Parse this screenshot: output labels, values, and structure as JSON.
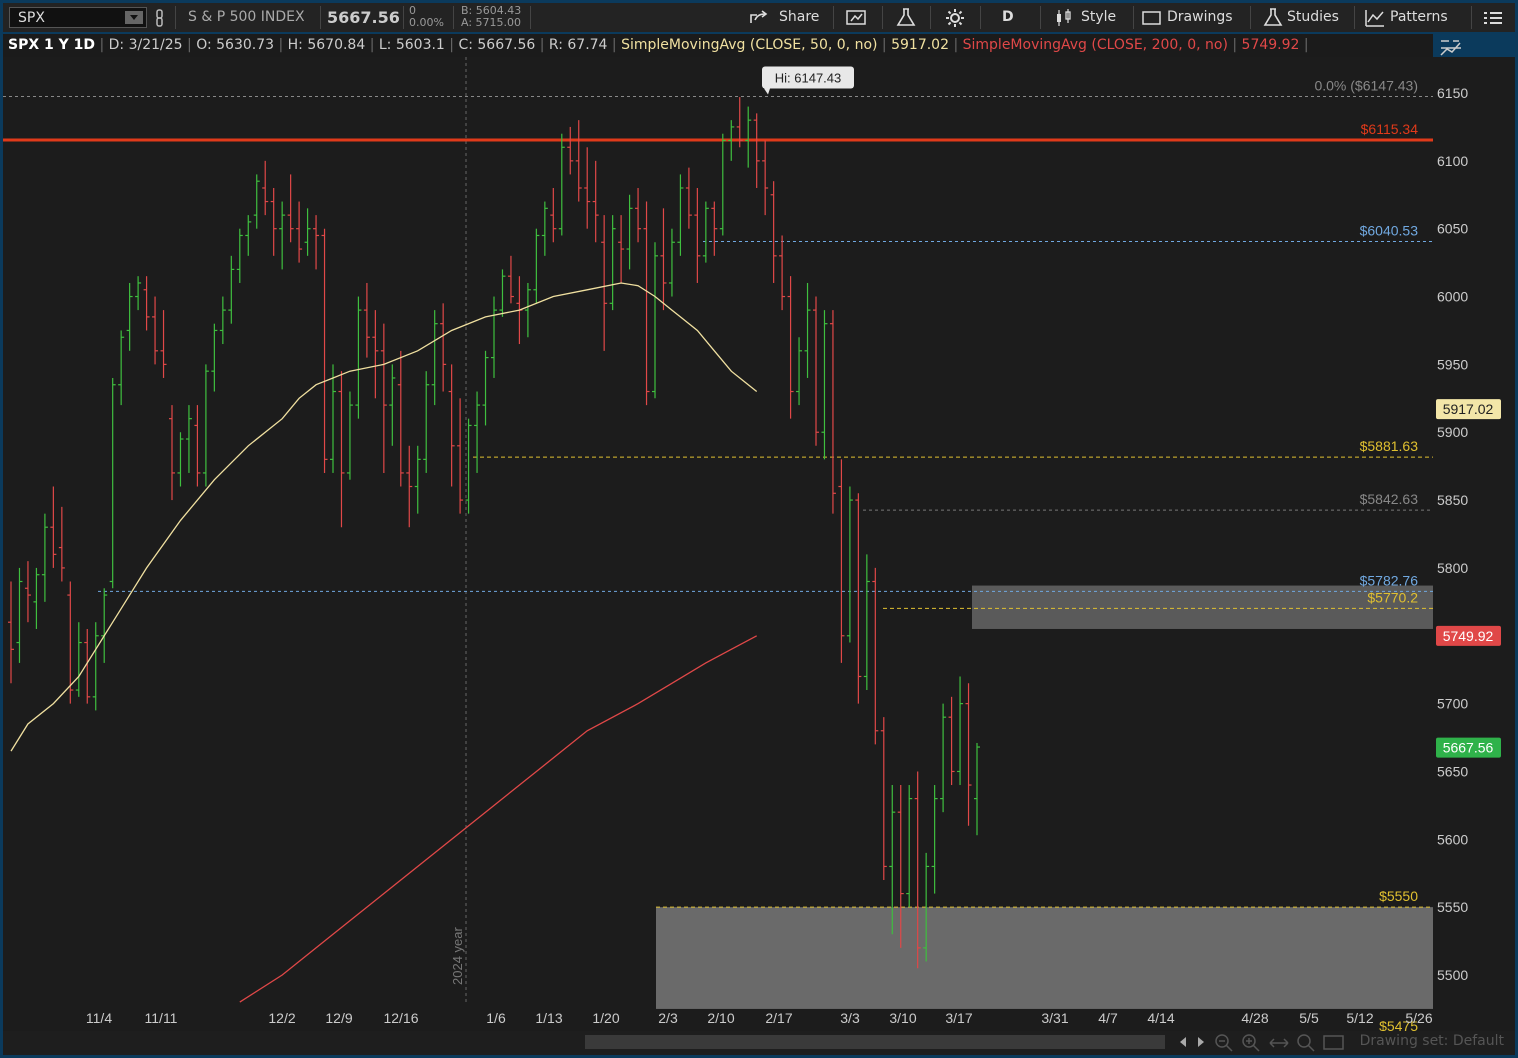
{
  "toolbar": {
    "symbol": "SPX",
    "name": "S & P 500 INDEX",
    "last": "5667.56",
    "change": "0",
    "change_pct": "0.00%",
    "bid": "B: 5604.43",
    "ask": "A: 5715.00",
    "share": "Share",
    "period": "D",
    "style": "Style",
    "drawings": "Drawings",
    "studies": "Studies",
    "patterns": "Patterns"
  },
  "infobar": {
    "label": "SPX 1 Y 1D",
    "date": "D: 3/21/25",
    "open": "O: 5630.73",
    "high": "H: 5670.84",
    "low": "L: 5603.1",
    "close": "C: 5667.56",
    "range": "R: 67.74",
    "sma50_label": "SimpleMovingAvg (CLOSE, 50, 0, no)",
    "sma50_value": "5917.02",
    "sma200_label": "SimpleMovingAvg (CLOSE, 200, 0, no)",
    "sma200_value": "5749.92"
  },
  "status": {
    "drawing_set": "Drawing set: Default"
  },
  "colors": {
    "up": "#3fbf3f",
    "down": "#e04848",
    "sma50": "#f0e0a0",
    "sma200": "#e04848",
    "gold": "#e0c030",
    "blue": "#70a8e0",
    "gray": "#888888"
  },
  "chart_data": {
    "type": "ohlc",
    "y_ticks": [
      5500,
      5550,
      5600,
      5650,
      5700,
      5750,
      5800,
      5850,
      5900,
      5950,
      6000,
      6050,
      6100,
      6150
    ],
    "ylim": [
      5455,
      6180
    ],
    "x_labels": [
      "11/4",
      "11/11",
      "12/2",
      "12/9",
      "12/16",
      "1/6",
      "1/13",
      "1/20",
      "2/3",
      "2/10",
      "2/17",
      "3/3",
      "3/10",
      "3/17",
      "3/31",
      "4/7",
      "4/14",
      "4/28",
      "5/5",
      "5/12",
      "5/26"
    ],
    "year_label": "2024 year",
    "high_label": "Hi: 6147.43",
    "fib_label": "0.0% ($6147.43)",
    "price_tags": {
      "sma50": "5917.02",
      "sma200": "5749.92",
      "last": "5667.56"
    },
    "levels": [
      {
        "label": "$6115.34",
        "value": 6115.34
      },
      {
        "label": "$6040.53",
        "value": 6040.53
      },
      {
        "label": "$5881.63",
        "value": 5881.63
      },
      {
        "label": "$5842.63",
        "value": 5842.63
      },
      {
        "label": "$5782.76",
        "value": 5782.76
      },
      {
        "label": "$5770.2",
        "value": 5770.2
      },
      {
        "label": "$5550",
        "value": 5550
      },
      {
        "label": "$5475",
        "value": 5475
      }
    ],
    "zones": [
      [
        5755,
        5787
      ],
      [
        5475,
        5550
      ]
    ],
    "bars_ohlc": [
      [
        5760,
        5790,
        5715,
        5740
      ],
      [
        5745,
        5800,
        5730,
        5790
      ],
      [
        5785,
        5805,
        5760,
        5780
      ],
      [
        5775,
        5800,
        5755,
        5795
      ],
      [
        5795,
        5840,
        5775,
        5830
      ],
      [
        5830,
        5860,
        5800,
        5810
      ],
      [
        5815,
        5845,
        5790,
        5800
      ],
      [
        5780,
        5790,
        5700,
        5710
      ],
      [
        5710,
        5760,
        5705,
        5745
      ],
      [
        5745,
        5755,
        5700,
        5705
      ],
      [
        5705,
        5760,
        5695,
        5750
      ],
      [
        5750,
        5785,
        5730,
        5780
      ],
      [
        5790,
        5940,
        5785,
        5935
      ],
      [
        5935,
        5975,
        5920,
        5970
      ],
      [
        5975,
        6010,
        5960,
        6000
      ],
      [
        6000,
        6015,
        5990,
        6010
      ],
      [
        6005,
        6015,
        5975,
        5985
      ],
      [
        5985,
        6000,
        5950,
        5960
      ],
      [
        5960,
        5990,
        5940,
        5950
      ],
      [
        5910,
        5920,
        5850,
        5870
      ],
      [
        5870,
        5900,
        5860,
        5895
      ],
      [
        5895,
        5920,
        5870,
        5910
      ],
      [
        5905,
        5920,
        5860,
        5870
      ],
      [
        5870,
        5950,
        5860,
        5945
      ],
      [
        5945,
        5980,
        5930,
        5975
      ],
      [
        5975,
        6000,
        5965,
        5990
      ],
      [
        5990,
        6030,
        5980,
        6020
      ],
      [
        6020,
        6050,
        6010,
        6045
      ],
      [
        6045,
        6060,
        6030,
        6055
      ],
      [
        6060,
        6090,
        6050,
        6085
      ],
      [
        6080,
        6100,
        6060,
        6070
      ],
      [
        6070,
        6080,
        6030,
        6050
      ],
      [
        6050,
        6070,
        6020,
        6060
      ],
      [
        6060,
        6090,
        6040,
        6050
      ],
      [
        6050,
        6070,
        6025,
        6035
      ],
      [
        6040,
        6065,
        6030,
        6050
      ],
      [
        6050,
        6060,
        6020,
        6045
      ],
      [
        6045,
        6050,
        5870,
        5880
      ],
      [
        5880,
        5950,
        5870,
        5930
      ],
      [
        5930,
        5945,
        5830,
        5870
      ],
      [
        5870,
        5930,
        5865,
        5920
      ],
      [
        5920,
        6000,
        5910,
        5990
      ],
      [
        5990,
        6010,
        5955,
        5970
      ],
      [
        5970,
        5990,
        5925,
        5960
      ],
      [
        5960,
        5980,
        5870,
        5920
      ],
      [
        5920,
        5950,
        5890,
        5940
      ],
      [
        5935,
        5960,
        5860,
        5870
      ],
      [
        5870,
        5890,
        5830,
        5860
      ],
      [
        5860,
        5890,
        5840,
        5880
      ],
      [
        5880,
        5945,
        5870,
        5935
      ],
      [
        5935,
        5990,
        5920,
        5980
      ],
      [
        5980,
        5995,
        5930,
        5950
      ],
      [
        5930,
        5950,
        5860,
        5890
      ],
      [
        5890,
        5925,
        5840,
        5850
      ],
      [
        5850,
        5910,
        5840,
        5905
      ],
      [
        5905,
        5930,
        5870,
        5920
      ],
      [
        5920,
        5960,
        5905,
        5955
      ],
      [
        5955,
        6000,
        5940,
        5990
      ],
      [
        5990,
        6020,
        5985,
        6015
      ],
      [
        6015,
        6030,
        5995,
        6000
      ],
      [
        5995,
        6015,
        5965,
        5990
      ],
      [
        5990,
        6010,
        5970,
        6005
      ],
      [
        6005,
        6050,
        5995,
        6045
      ],
      [
        6045,
        6070,
        6030,
        6065
      ],
      [
        6060,
        6080,
        6040,
        6050
      ],
      [
        6050,
        6120,
        6045,
        6110
      ],
      [
        6110,
        6125,
        6090,
        6100
      ],
      [
        6100,
        6130,
        6070,
        6080
      ],
      [
        6080,
        6110,
        6050,
        6070
      ],
      [
        6070,
        6100,
        6040,
        6060
      ],
      [
        6040,
        6060,
        5960,
        5995
      ],
      [
        5995,
        6060,
        5990,
        6050
      ],
      [
        6040,
        6060,
        6010,
        6035
      ],
      [
        6035,
        6075,
        6020,
        6065
      ],
      [
        6065,
        6080,
        6040,
        6050
      ],
      [
        6050,
        6070,
        5920,
        5930
      ],
      [
        5930,
        6040,
        5925,
        6030
      ],
      [
        6030,
        6065,
        5990,
        6010
      ],
      [
        6010,
        6050,
        6000,
        6040
      ],
      [
        6040,
        6090,
        6030,
        6080
      ],
      [
        6080,
        6095,
        6050,
        6060
      ],
      [
        6060,
        6080,
        6010,
        6030
      ],
      [
        6030,
        6070,
        6025,
        6065
      ],
      [
        6065,
        6070,
        6030,
        6050
      ],
      [
        6050,
        6120,
        6045,
        6115
      ],
      [
        6115,
        6130,
        6100,
        6125
      ],
      [
        6125,
        6147,
        6110,
        6115
      ],
      [
        6115,
        6140,
        6095,
        6130
      ],
      [
        6130,
        6135,
        6080,
        6100
      ],
      [
        6100,
        6115,
        6060,
        6080
      ],
      [
        6075,
        6085,
        6010,
        6030
      ],
      [
        6030,
        6045,
        5990,
        6000
      ],
      [
        6000,
        6015,
        5910,
        5930
      ],
      [
        5930,
        5970,
        5920,
        5960
      ],
      [
        5960,
        6010,
        5940,
        5990
      ],
      [
        5990,
        6000,
        5890,
        5900
      ],
      [
        5900,
        5990,
        5880,
        5980
      ],
      [
        5980,
        5990,
        5840,
        5855
      ],
      [
        5860,
        5880,
        5730,
        5750
      ],
      [
        5750,
        5860,
        5745,
        5850
      ],
      [
        5850,
        5855,
        5700,
        5720
      ],
      [
        5720,
        5810,
        5710,
        5790
      ],
      [
        5790,
        5800,
        5670,
        5680
      ],
      [
        5680,
        5690,
        5570,
        5580
      ],
      [
        5580,
        5640,
        5530,
        5620
      ],
      [
        5620,
        5640,
        5520,
        5560
      ],
      [
        5560,
        5640,
        5550,
        5630
      ],
      [
        5630,
        5650,
        5505,
        5520
      ],
      [
        5520,
        5590,
        5510,
        5580
      ],
      [
        5580,
        5640,
        5560,
        5630
      ],
      [
        5630,
        5700,
        5620,
        5690
      ],
      [
        5690,
        5705,
        5640,
        5650
      ],
      [
        5650,
        5720,
        5640,
        5700
      ],
      [
        5700,
        5715,
        5610,
        5640
      ],
      [
        5630,
        5671,
        5603,
        5668
      ]
    ],
    "sma50_points": [
      [
        0,
        5665
      ],
      [
        2,
        5685
      ],
      [
        5,
        5700
      ],
      [
        8,
        5720
      ],
      [
        12,
        5760
      ],
      [
        16,
        5800
      ],
      [
        20,
        5835
      ],
      [
        24,
        5865
      ],
      [
        28,
        5890
      ],
      [
        32,
        5910
      ],
      [
        34,
        5925
      ],
      [
        36,
        5935
      ],
      [
        38,
        5940
      ],
      [
        40,
        5945
      ],
      [
        44,
        5950
      ],
      [
        48,
        5960
      ],
      [
        52,
        5975
      ],
      [
        56,
        5985
      ],
      [
        60,
        5990
      ],
      [
        64,
        6000
      ],
      [
        68,
        6005
      ],
      [
        72,
        6010
      ],
      [
        74,
        6008
      ],
      [
        76,
        6000
      ],
      [
        78,
        5990
      ],
      [
        79,
        5985
      ],
      [
        81,
        5975
      ],
      [
        83,
        5960
      ],
      [
        85,
        5945
      ],
      [
        88,
        5930
      ]
    ],
    "sma200_points": [
      [
        27,
        5480
      ],
      [
        32,
        5500
      ],
      [
        38,
        5530
      ],
      [
        44,
        5560
      ],
      [
        50,
        5590
      ],
      [
        56,
        5620
      ],
      [
        62,
        5650
      ],
      [
        68,
        5680
      ],
      [
        74,
        5700
      ],
      [
        78,
        5715
      ],
      [
        82,
        5730
      ],
      [
        85,
        5740
      ],
      [
        88,
        5750
      ]
    ]
  }
}
